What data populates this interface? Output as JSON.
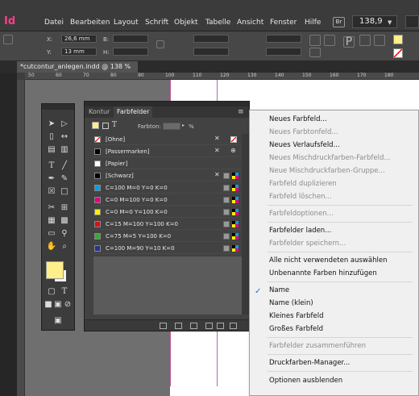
{
  "menubar": {
    "logo": "Id",
    "items": [
      "Datei",
      "Bearbeiten",
      "Layout",
      "Schrift",
      "Objekt",
      "Tabelle",
      "Ansicht",
      "Fenster",
      "Hilfe"
    ],
    "br_label": "Br",
    "zoom": "138,9"
  },
  "control": {
    "x_label": "X:",
    "x_value": "26,6 mm",
    "y_label": "Y:",
    "y_value": "13 mm",
    "b_label": "B:",
    "h_label": "H:",
    "p_glyph": "P"
  },
  "document": {
    "tab_title": "*cutcontur_anlegen.indd @ 138 %",
    "close_glyph": "×"
  },
  "ruler": {
    "ticks": [
      "50",
      "60",
      "70",
      "80",
      "90",
      "100",
      "110",
      "120",
      "130",
      "140",
      "150",
      "160",
      "170",
      "180"
    ]
  },
  "swatches": {
    "tab_kontur": "Kontur",
    "tab_farbfelder": "Farbfelder",
    "tint_label": "Farbton:",
    "tint_unit": "%",
    "items": [
      {
        "name": "[Ohne]",
        "color": "none"
      },
      {
        "name": "[Passermarken]",
        "color": "#000000"
      },
      {
        "name": "[Papier]",
        "color": "#ffffff"
      },
      {
        "name": "[Schwarz]",
        "color": "#000000"
      },
      {
        "name": "C=100 M=0 Y=0 K=0",
        "color": "#00a0e6"
      },
      {
        "name": "C=0 M=100 Y=0 K=0",
        "color": "#e6007e"
      },
      {
        "name": "C=0 M=0 Y=100 K=0",
        "color": "#fff000"
      },
      {
        "name": "C=15 M=100 Y=100 K=0",
        "color": "#d2121b"
      },
      {
        "name": "C=75 M=5 Y=100 K=0",
        "color": "#3aa935"
      },
      {
        "name": "C=100 M=90 Y=10 K=0",
        "color": "#26358b"
      }
    ]
  },
  "menu": {
    "items": [
      {
        "label": "Neues Farbfeld...",
        "enabled": true
      },
      {
        "label": "Neues Farbtonfeld...",
        "enabled": false
      },
      {
        "label": "Neues Verlaufsfeld...",
        "enabled": true
      },
      {
        "label": "Neues Mischdruckfarben-Farbfeld...",
        "enabled": false
      },
      {
        "label": "Neue Mischdruckfarben-Gruppe...",
        "enabled": false
      },
      {
        "label": "Farbfeld duplizieren",
        "enabled": false
      },
      {
        "label": "Farbfeld löschen...",
        "enabled": false
      },
      {
        "label": "Farbfeldoptionen...",
        "enabled": false
      },
      {
        "label": "Farbfelder laden...",
        "enabled": true
      },
      {
        "label": "Farbfelder speichern...",
        "enabled": false
      },
      {
        "label": "Alle nicht verwendeten auswählen",
        "enabled": true
      },
      {
        "label": "Unbenannte Farben hinzufügen",
        "enabled": true
      },
      {
        "label": "Name",
        "enabled": true,
        "checked": true
      },
      {
        "label": "Name (klein)",
        "enabled": true
      },
      {
        "label": "Kleines Farbfeld",
        "enabled": true
      },
      {
        "label": "Großes Farbfeld",
        "enabled": true
      },
      {
        "label": "Farbfelder zusammenführen",
        "enabled": false
      },
      {
        "label": "Druckfarben-Manager...",
        "enabled": true
      },
      {
        "label": "Optionen ausblenden",
        "enabled": true
      }
    ],
    "check_glyph": "✓"
  },
  "colors": {
    "fill": "#ffef8a",
    "accent": "#ff3d8e"
  }
}
